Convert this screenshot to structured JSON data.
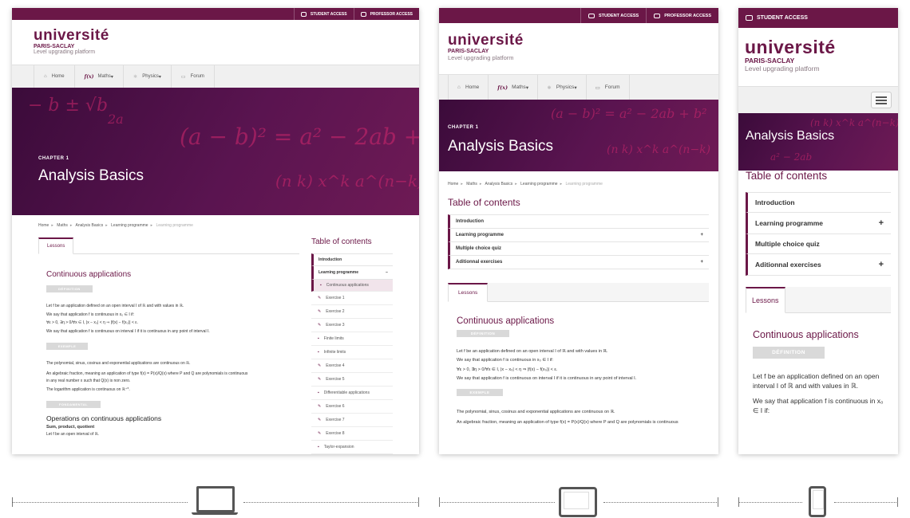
{
  "brand": {
    "name": "université",
    "sub": "PARIS-SACLAY",
    "tagline": "Level upgrading platform",
    "accent": "#6b1747"
  },
  "topbar": {
    "student": "STUDENT ACCESS",
    "professor": "PROFESSOR ACCESS"
  },
  "nav": {
    "home": "Home",
    "maths": "Maths",
    "physics": "Physics",
    "forum": "Forum",
    "maths_icon": "f(x)"
  },
  "hero": {
    "chapter": "CHAPTER 1",
    "title": "Analysis Basics"
  },
  "breadcrumb": [
    "Home",
    "Maths",
    "Analysis Basics",
    "Learning programme",
    "Learning programme"
  ],
  "toc": {
    "title": "Table of contents",
    "items": [
      "Introduction",
      "Learning programme",
      "Multiple choice quiz",
      "Aditionnal exercises"
    ],
    "subitems": [
      "Continuous applications",
      "Exercise 1",
      "Exercise 2",
      "Exercise 3",
      "Finite limits",
      "Infinite limits",
      "Exercise 4",
      "Exercise 5",
      "Differentiable applications",
      "Exercise 6",
      "Exercise 7",
      "Exercise 8",
      "Taylor-expansion"
    ]
  },
  "lesson": {
    "tab": "Lessons",
    "heading": "Continuous applications",
    "definition": "DÉFINITION",
    "example": "EXEMPLE",
    "fundamental": "FONDAMENTAL",
    "p1": "Let f be an application defined on an open interval I of ℝ and with values in ℝ.",
    "p2": "We say that application f is continuous in x₀ ∈ I if:",
    "p3": "∀ε > 0, ∃η > 0/∀x ∈ I, |x − x₀| < η ⇒ |f(x) − f(x₀)| < ε.",
    "p4": "We say that application f is continuous on interval I if it is continuous in any point of interval I.",
    "p5": "The polynomial, sinus, cosinus and exponential applications are continuous on ℝ.",
    "p6": "An algebraic fraction, meaning an application of type f(x) = P(x)/Q(x) where P and Q are polynomials is continuous",
    "p6b": "in any real number x such that Q(x) is non zero.",
    "p7": "The logarithm application is continuous on ℝ⁺*.",
    "h2": "Operations on continuous applications",
    "h3": "Sum, product, quotient",
    "p8": "Let f be an open interval of ℝ.",
    "m_p1": "Let f be an application defined on an open interval I of ℝ and with values in ℝ.",
    "m_p2": "We say that application f is continuous in x₀ ∈ I if:"
  },
  "mobile": {
    "student": "STUDENT ACCESS"
  }
}
